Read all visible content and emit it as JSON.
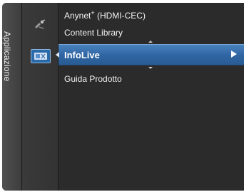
{
  "sidebar": {
    "label": "Applicazione"
  },
  "icons": {
    "top": "satellite-dish-icon",
    "selected": "tv-info-icon"
  },
  "menu": {
    "items": [
      {
        "label": "Anynet",
        "suffix": "+",
        "tail": " (HDMI-CEC)"
      },
      {
        "label": "Content Library"
      },
      {
        "label": "InfoLive"
      },
      {
        "label": "Guida Prodotto"
      }
    ]
  },
  "colors": {
    "highlight": "#2f66a3",
    "panel": "#2b2b2b"
  }
}
